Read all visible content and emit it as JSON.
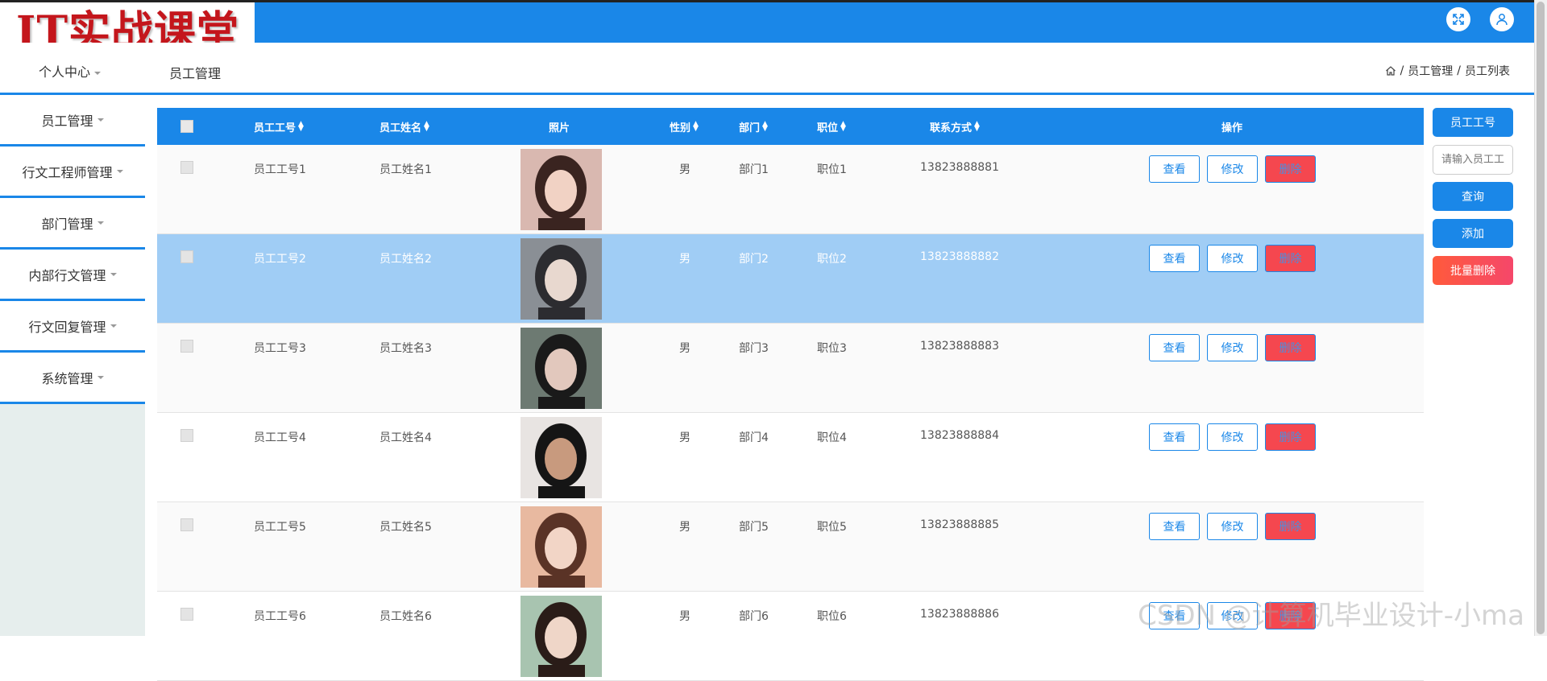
{
  "header": {
    "logo_text": "IT实战课堂",
    "fullscreen_icon": "fullscreen-icon",
    "user_icon": "user-icon"
  },
  "nav": {
    "personal_center": "个人中心",
    "active_tab": "员工管理",
    "breadcrumb": [
      "员工管理",
      "员工列表"
    ],
    "home_icon": "home-icon"
  },
  "sidebar": {
    "items": [
      {
        "label": "员工管理"
      },
      {
        "label": "行文工程师管理"
      },
      {
        "label": "部门管理"
      },
      {
        "label": "内部行文管理"
      },
      {
        "label": "行文回复管理"
      },
      {
        "label": "系统管理"
      }
    ]
  },
  "table": {
    "headers": {
      "id": "员工工号",
      "name": "员工姓名",
      "photo": "照片",
      "gender": "性别",
      "dept": "部门",
      "position": "职位",
      "contact": "联系方式",
      "actions": "操作"
    },
    "action_labels": {
      "view": "查看",
      "edit": "修改",
      "delete": "删除"
    },
    "rows": [
      {
        "id": "员工工号1",
        "name": "员工姓名1",
        "gender": "男",
        "dept": "部门1",
        "position": "职位1",
        "contact": "13823888881",
        "photo_colors": [
          "#d9b8b0",
          "#3a2420",
          "#f1d2c4"
        ]
      },
      {
        "id": "员工工号2",
        "name": "员工姓名2",
        "gender": "男",
        "dept": "部门2",
        "position": "职位2",
        "contact": "13823888882",
        "photo_colors": [
          "#8a8f95",
          "#2c2c30",
          "#e8d8cf"
        ]
      },
      {
        "id": "员工工号3",
        "name": "员工姓名3",
        "gender": "男",
        "dept": "部门3",
        "position": "职位3",
        "contact": "13823888883",
        "photo_colors": [
          "#6d7a72",
          "#1a1a1a",
          "#e2c8bd"
        ]
      },
      {
        "id": "员工工号4",
        "name": "员工姓名4",
        "gender": "男",
        "dept": "部门4",
        "position": "职位4",
        "contact": "13823888884",
        "photo_colors": [
          "#e8e4e2",
          "#151515",
          "#c89a7e"
        ]
      },
      {
        "id": "员工工号5",
        "name": "员工姓名5",
        "gender": "男",
        "dept": "部门5",
        "position": "职位5",
        "contact": "13823888885",
        "photo_colors": [
          "#e8b9a0",
          "#5a3326",
          "#f2d5c6"
        ]
      },
      {
        "id": "员工工号6",
        "name": "员工姓名6",
        "gender": "男",
        "dept": "部门6",
        "position": "职位6",
        "contact": "13823888886",
        "photo_colors": [
          "#a8c4b0",
          "#2a1c18",
          "#efd6c8"
        ]
      }
    ]
  },
  "right_panel": {
    "field_label": "员工工号",
    "search_placeholder": "请输入员工工号",
    "query": "查询",
    "add": "添加",
    "batch_delete": "批量删除"
  },
  "watermark": "CSDN @计算机毕业设计-小ma",
  "colors": {
    "primary": "#1a87e8",
    "danger": "#f5474f",
    "selected_row": "#a0cdf5",
    "logo_red": "#c4161c"
  }
}
